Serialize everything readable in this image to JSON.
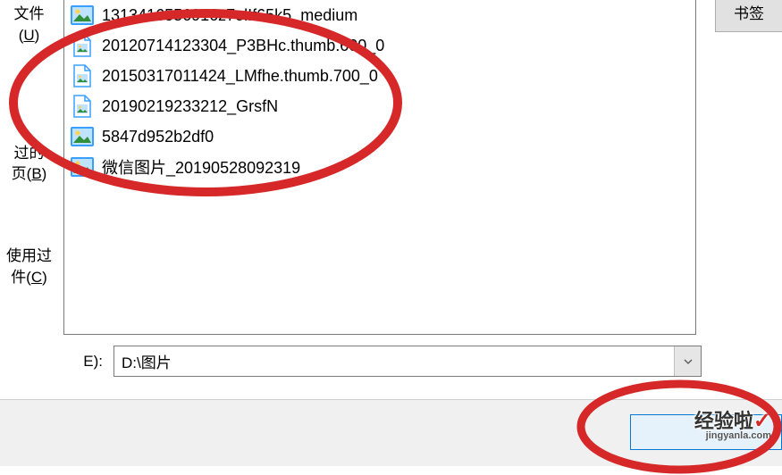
{
  "sidebar": {
    "items": [
      {
        "label_line1": "文件",
        "accel": "U",
        "accel_wrap": "(U)"
      },
      {
        "label_line1": "过的",
        "label_line2_prefix": "页(",
        "accel": "B",
        "label_line2_suffix": ")"
      },
      {
        "label_line1": "使用过",
        "label_line2_prefix": "件(",
        "accel": "C",
        "label_line2_suffix": ")"
      }
    ]
  },
  "files": [
    {
      "icon": "image-large",
      "name": "1313416556916z7olIf65k5_medium"
    },
    {
      "icon": "image-small",
      "name": "20120714123304_P3BHc.thumb.600_0"
    },
    {
      "icon": "image-small",
      "name": "20150317011424_LMfhe.thumb.700_0"
    },
    {
      "icon": "image-small",
      "name": "20190219233212_GrsfN"
    },
    {
      "icon": "image-large",
      "name": "5847d952b2df0"
    },
    {
      "icon": "image-large",
      "name": "微信图片_20190528092319"
    }
  ],
  "pathRow": {
    "label": "E):",
    "value": "D:\\图片"
  },
  "rightButtons": {
    "bookmark": "书签"
  },
  "watermark": {
    "main": "经验啦",
    "check": "✓",
    "sub": "jingyanla.com"
  },
  "annotationColor": "#d62828"
}
